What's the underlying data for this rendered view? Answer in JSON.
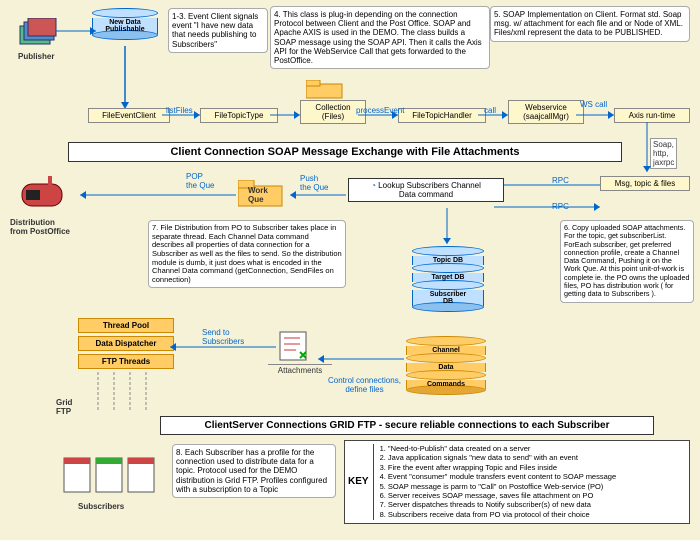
{
  "publisher": {
    "label": "Publisher",
    "new_data": "New Data\nPublishable"
  },
  "steps": {
    "s1": "1-3. Event Client signals event \"I have new data that needs publishing to Subscribers\"",
    "s4": "4. This class is plug-in depending on the connection Protocol between Client and the Post Office. SOAP and Apache AXIS is used in the DEMO. The class builds a SOAP message using the SOAP API. Then it calls the Axis API for the WebService Call that gets forwarded to the PostOffice.",
    "s5": "5. SOAP Implementation on Client. Format std. Soap msg. w/ attachment for each file and or Node of XML. Files/xml represent the data to be PUBLISHED.",
    "s6": "6. Copy uploaded SOAP attachments. For the topic, get subscriberList. ForEach subscriber, get preferred connection profile, create a Channel Data Command, Pushing it on the Work Que. At this point unit-of-work is complete ie. the PO owns the uploaded files, PO has distribution work ( for getting data to Subscribers ).",
    "s7": "7. File Distribution from PO to Subscriber takes place in separate thread. Each Channel Data command describes all properties of data connection for a Subscriber as well as the files to send. So the distribution module is dumb, it just does what is encoded in the Channel Data command (getConnection, SendFiles on connection)",
    "s8": "8. Each Subscriber has a profile for the connection used to distribute data for a topic. Protocol used for the DEMO distribution is Grid FTP. Profiles configured with a subscription to a Topic"
  },
  "nodes": {
    "fileEventClient": "FileEventClient",
    "fileTopicType": "FileTopicType",
    "collection": "Collection\n(Files)",
    "fileTopicHandler": "FileTopicHandler",
    "webservice": "Webservice\n(saajcallMgr)",
    "axis": "Axis run-time",
    "msg": "Msg, topic & files",
    "lookup": "Lookup Subscribers Channel\nData command",
    "workQue": "Work\nQue",
    "distPO": "Distribution\nfrom PostOffice",
    "attachments": "Attachments"
  },
  "labels": {
    "listFiles": "listFiles",
    "processEvent": "processEvent",
    "call": "call",
    "wscall": "WS call",
    "soap": "Soap,\nhttp,\njaxrpc",
    "rpc1": "RPC",
    "rpc2": "RPC",
    "push": "Push\nthe Que",
    "pop": "POP\nthe Que",
    "send": "Send to\nSubscribers",
    "ctrl": "Control  connections,\ndefine files",
    "grid": "Grid\nFTP"
  },
  "titles": {
    "t1": "Client Connection SOAP Message Exchange with File Attachments",
    "t2": "ClientServer Connections GRID FTP -  secure reliable connections to each Subscriber"
  },
  "threadstack": {
    "a": "Thread Pool",
    "b": "Data Dispatcher",
    "c": "FTP Threads"
  },
  "dbs": {
    "topic": "Topic DB",
    "target": "Target DB",
    "sub": "Subscriber\nDB"
  },
  "cmds": {
    "a": "Channel",
    "b": "Data",
    "c": "Commands"
  },
  "subscribers": "Subscribers",
  "key": {
    "title": "KEY",
    "k1": "1. \"Need-to-Publish\" data created on a server",
    "k2": "2. Java application signals \"new data to send\" with an event",
    "k3": "3. Fire the event after wrapping Topic and Files inside",
    "k4": "4. Event \"consumer\" module transfers event content to SOAP message",
    "k5": "5. SOAP message is parm to \"Call\" on Postoffice Web-service (PO)",
    "k6": "6. Server receives SOAP message, saves file attachment on PO",
    "k7": "7. Server dispatches threads to Notify subscriber(s) of new data",
    "k8": "8. Subscribers receive data from PO via protocol of their choice"
  }
}
